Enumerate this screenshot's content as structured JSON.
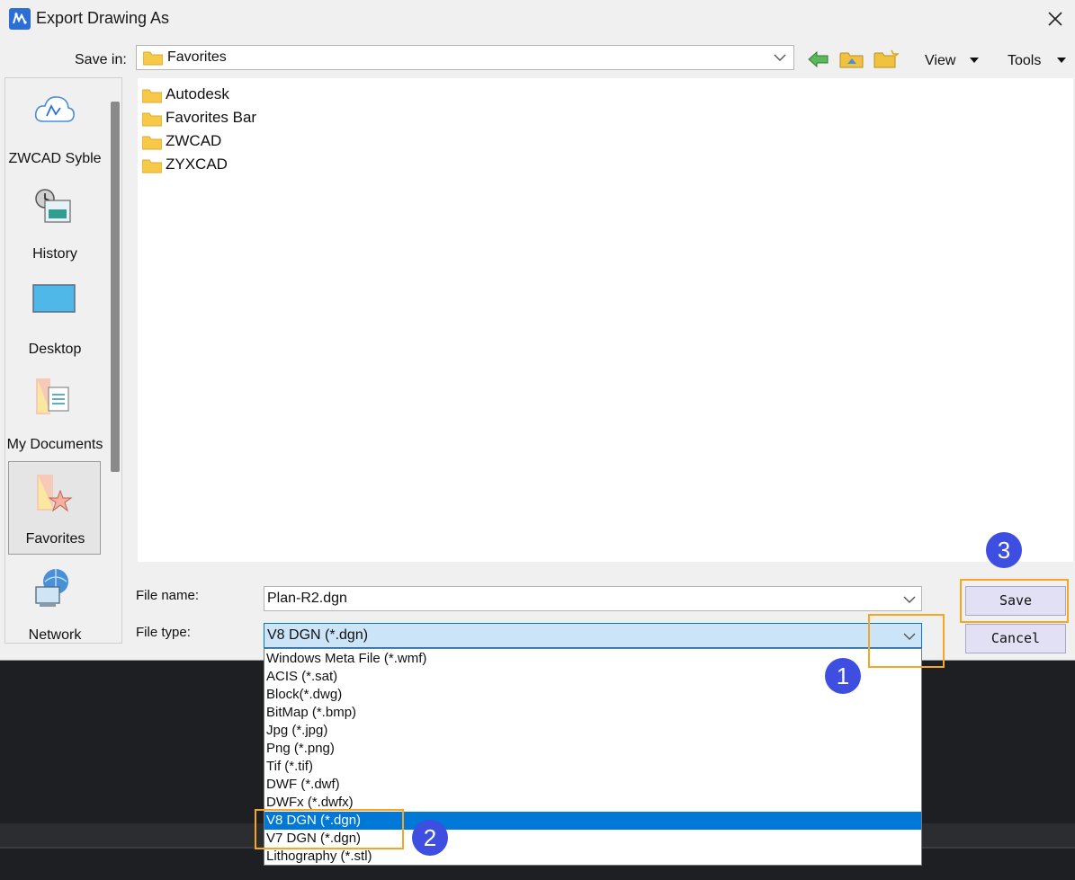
{
  "window": {
    "title": "Export Drawing As",
    "icon": "zwcad-app-icon",
    "close_icon": "close-icon"
  },
  "toolbar": {
    "save_in_label": "Save in:",
    "save_in_value": "Favorites",
    "back_icon": "back-arrow-icon",
    "up_icon": "up-folder-icon",
    "new_folder_icon": "new-folder-icon",
    "view_label": "View",
    "tools_label": "Tools"
  },
  "places": [
    {
      "label": "ZWCAD Syble",
      "icon": "cloud-icon"
    },
    {
      "label": "History",
      "icon": "history-icon"
    },
    {
      "label": "Desktop",
      "icon": "desktop-icon"
    },
    {
      "label": "My Documents",
      "icon": "documents-icon"
    },
    {
      "label": "Favorites",
      "icon": "favorites-icon",
      "selected": true
    },
    {
      "label": "Network",
      "icon": "network-icon"
    }
  ],
  "files": [
    {
      "name": "Autodesk",
      "icon": "folder-icon"
    },
    {
      "name": "Favorites Bar",
      "icon": "folder-icon"
    },
    {
      "name": "ZWCAD",
      "icon": "folder-icon"
    },
    {
      "name": "ZYXCAD",
      "icon": "folder-icon"
    }
  ],
  "form": {
    "file_name_label": "File name:",
    "file_name_value": "Plan-R2.dgn",
    "file_type_label": "File type:",
    "file_type_value": "V8 DGN (*.dgn)"
  },
  "buttons": {
    "save": "Save",
    "cancel": "Cancel"
  },
  "file_type_options": [
    "Windows Meta File (*.wmf)",
    "ACIS (*.sat)",
    "Block(*.dwg)",
    "BitMap (*.bmp)",
    "Jpg (*.jpg)",
    "Png (*.png)",
    "Tif (*.tif)",
    "DWF (*.dwf)",
    "DWFx (*.dwfx)",
    "V8 DGN (*.dgn)",
    "V7 DGN (*.dgn)",
    "Lithography (*.stl)"
  ],
  "selected_option_index": 9,
  "step_markers": [
    "1",
    "2",
    "3"
  ],
  "colors": {
    "accent": "#0078d7",
    "highlight": "#f5a623",
    "step_badge": "#3d4ee0"
  }
}
